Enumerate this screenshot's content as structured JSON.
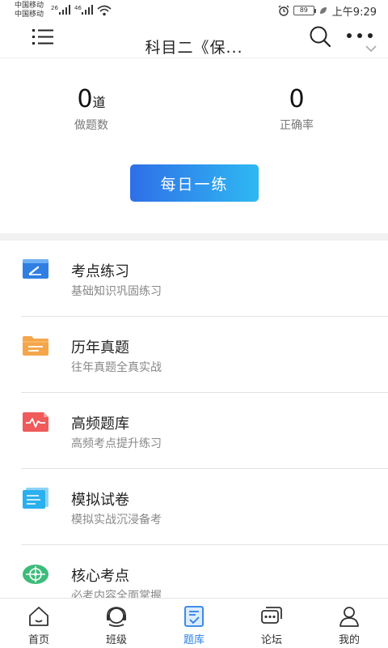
{
  "status_bar": {
    "carrier_1": "中国移动",
    "carrier_2": "中国移动",
    "net_1": "26",
    "net_2": "46",
    "battery": "89",
    "time": "上午9:29"
  },
  "header": {
    "title": "科目二《保...",
    "icons": [
      "menu-icon",
      "search-icon",
      "more-icon",
      "chevron-down-icon"
    ]
  },
  "stats": {
    "questions_done": {
      "value": "0",
      "unit": "道",
      "label": "做题数"
    },
    "accuracy": {
      "value": "0",
      "label": "正确率"
    }
  },
  "daily_practice": {
    "label": "每日一练"
  },
  "practice_list": [
    {
      "title": "考点练习",
      "subtitle": "基础知识巩固练习",
      "icon": "pencil-card-icon",
      "color": "#2f7fe3"
    },
    {
      "title": "历年真题",
      "subtitle": "往年真题全真实战",
      "icon": "folder-icon",
      "color": "#f5a64a"
    },
    {
      "title": "高频题库",
      "subtitle": "高频考点提升练习",
      "icon": "pulse-card-icon",
      "color": "#f05a5a"
    },
    {
      "title": "模拟试卷",
      "subtitle": "模拟实战沉浸备考",
      "icon": "document-icon",
      "color": "#2ab0ee"
    },
    {
      "title": "核心考点",
      "subtitle": "必考内容全面掌握",
      "icon": "target-icon",
      "color": "#3dbb7a"
    }
  ],
  "tab_bar": {
    "active": 2,
    "active_color": "#2a7fe6",
    "tabs": [
      {
        "label": "首页",
        "icon": "home-icon"
      },
      {
        "label": "班级",
        "icon": "class-icon"
      },
      {
        "label": "题库",
        "icon": "question-bank-icon"
      },
      {
        "label": "论坛",
        "icon": "forum-icon"
      },
      {
        "label": "我的",
        "icon": "profile-icon"
      }
    ]
  }
}
